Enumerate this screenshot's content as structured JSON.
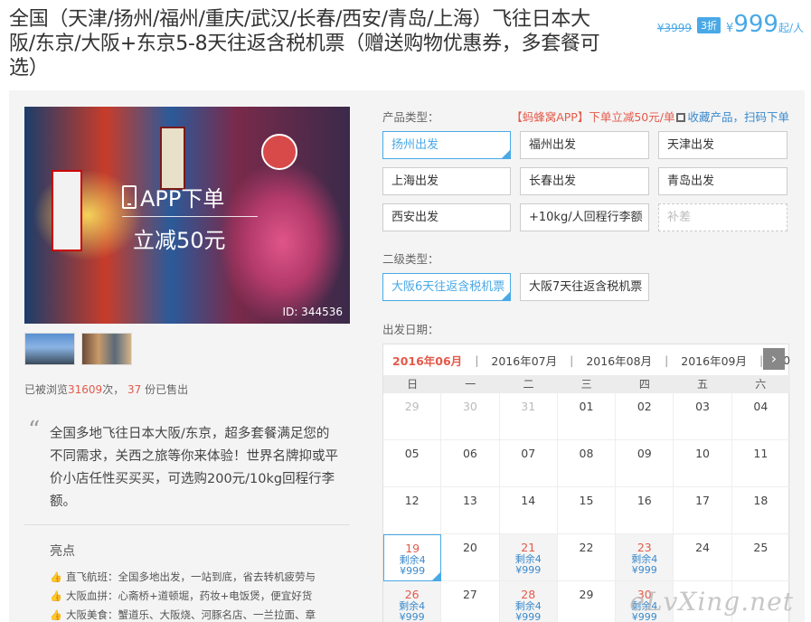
{
  "product": {
    "title": "全国（天津/扬州/福州/重庆/武汉/长春/西安/青岛/上海）飞往日本大阪/东京/大阪+东京5-8天往返含税机票（赠送购物优惠券，多套餐可选）",
    "old_price": "¥3999",
    "discount": "3折",
    "currency": "¥",
    "price": "999",
    "unit": "起/人"
  },
  "gallery": {
    "app_text": "APP下单",
    "save_text": "立减50元",
    "id_text": "ID: 344536"
  },
  "stats": {
    "pre": "已被浏览",
    "views": "31609",
    "mid": "次，",
    "sold": "37",
    "post": "份已售出"
  },
  "description": "全国多地飞往日本大阪/东京，超多套餐满足您的不同需求，关西之旅等你来体验！世界名牌抑或平价小店任性买买买，可选购200元/10kg回程行李额。",
  "highlights": {
    "title": "亮点",
    "items": [
      "直飞航班：全国多地出发，一站到底，省去转机疲劳与",
      "大阪血拼：心斋桥+道顿堀，药妆+电饭煲，便宜好货",
      "大阪美食：蟹道乐、大阪烧、河豚名店、一兰拉面、章"
    ]
  },
  "promo": {
    "red": "【蚂蜂窝APP】下单立减50元/单",
    "fav": "收藏产品",
    "sep": "，",
    "scan": "扫码下单"
  },
  "product_type": {
    "label": "产品类型：",
    "options": [
      "扬州出发",
      "福州出发",
      "天津出发",
      "上海出发",
      "长春出发",
      "青岛出发",
      "西安出发",
      "+10kg/人回程行李额",
      "补差"
    ]
  },
  "sub_type": {
    "label": "二级类型：",
    "options": [
      "大阪6天往返含税机票",
      "大阪7天往返含税机票"
    ]
  },
  "departure": {
    "label": "出发日期：",
    "months": [
      "2016年06月",
      "2016年07月",
      "2016年08月",
      "2016年09月",
      "20"
    ],
    "separator": "|",
    "next": "›",
    "weekdays": [
      "日",
      "一",
      "二",
      "三",
      "四",
      "五",
      "六"
    ],
    "days": [
      {
        "d": "29",
        "p": true
      },
      {
        "d": "30",
        "p": true
      },
      {
        "d": "31",
        "p": true
      },
      {
        "d": "01"
      },
      {
        "d": "02"
      },
      {
        "d": "03"
      },
      {
        "d": "04"
      },
      {
        "d": "05"
      },
      {
        "d": "06"
      },
      {
        "d": "07"
      },
      {
        "d": "08"
      },
      {
        "d": "09"
      },
      {
        "d": "10"
      },
      {
        "d": "11"
      },
      {
        "d": "12"
      },
      {
        "d": "13"
      },
      {
        "d": "14"
      },
      {
        "d": "15"
      },
      {
        "d": "16"
      },
      {
        "d": "17"
      },
      {
        "d": "18"
      },
      {
        "d": "19",
        "r": "剩余4",
        "pr": "¥999",
        "sel": true
      },
      {
        "d": "20"
      },
      {
        "d": "21",
        "r": "剩余4",
        "pr": "¥999"
      },
      {
        "d": "22"
      },
      {
        "d": "23",
        "r": "剩余4",
        "pr": "¥999"
      },
      {
        "d": "24"
      },
      {
        "d": "25"
      },
      {
        "d": "26",
        "r": "剩余4",
        "pr": "¥999"
      },
      {
        "d": "27"
      },
      {
        "d": "28",
        "r": "剩余4",
        "pr": "¥999"
      },
      {
        "d": "29"
      },
      {
        "d": "30",
        "r": "剩余4",
        "pr": "¥999"
      },
      {
        "d": ""
      },
      {
        "d": ""
      }
    ]
  },
  "watermark": "eLvXing.net"
}
